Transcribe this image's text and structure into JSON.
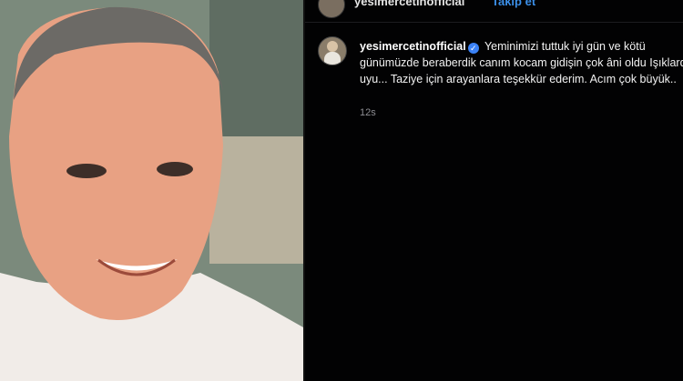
{
  "header": {
    "username": "yesimercetinofficial",
    "follow_label": "Takip et"
  },
  "comment": {
    "username": "yesimercetinofficial",
    "text": "Yeminimizi tuttuk iyi gün ve kötü günümüzde beraberdik canım kocam gidişin çok âni oldu Işıklarda uyu... Taziye için arayanlara teşekkür ederim. Acım çok büyük..",
    "time": "12s"
  },
  "icons": {
    "verified": "verified-badge-icon"
  }
}
